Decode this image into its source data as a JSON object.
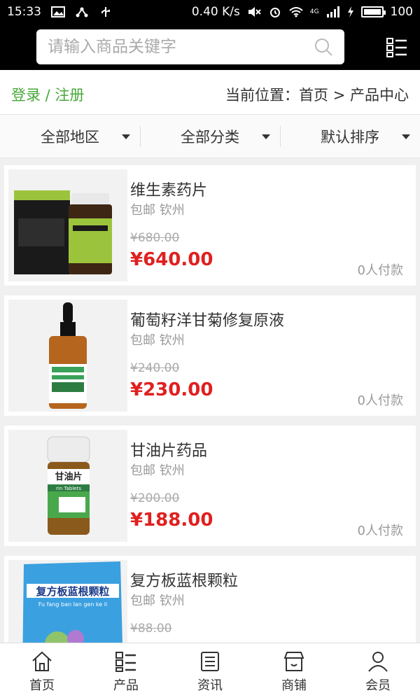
{
  "status_bar": {
    "time": "15:33",
    "speed": "0.40 K/s",
    "network": "4G",
    "battery": "100"
  },
  "search": {
    "placeholder": "请输入商品关键字"
  },
  "breadcrumb": {
    "login": "登录 / 注册",
    "location": "当前位置：首页 > 产品中心"
  },
  "filters": [
    {
      "label": "全部地区"
    },
    {
      "label": "全部分类"
    },
    {
      "label": "默认排序"
    }
  ],
  "products": [
    {
      "name": "维生素药片",
      "shipping": "包邮 钦州",
      "old_price": "¥680.00",
      "price": "¥640.00",
      "paid": "0人付款",
      "image": "vitamin-bottle-and-box"
    },
    {
      "name": "葡萄籽洋甘菊修复原液",
      "shipping": "包邮 钦州",
      "old_price": "¥240.00",
      "price": "¥230.00",
      "paid": "0人付款",
      "image": "dropper-bottle"
    },
    {
      "name": "甘油片药品",
      "shipping": "包邮 钦州",
      "old_price": "¥200.00",
      "price": "¥188.00",
      "paid": "0人付款",
      "image": "glycerin-tablets-bottle",
      "image_text": {
        "line1": "甘油片",
        "line2": "rin Tablets"
      }
    },
    {
      "name": "复方板蓝根颗粒",
      "shipping": "包邮 钦州",
      "old_price": "¥88.00",
      "price": "",
      "paid": "",
      "image": "banlangen-granules-pack",
      "image_text": {
        "line1": "复方板蓝根颗粒",
        "line2": "Fu fang ban lan gen ke li"
      }
    }
  ],
  "bottom_nav": [
    {
      "label": "首页",
      "icon": "home-icon"
    },
    {
      "label": "产品",
      "icon": "grid-list-icon"
    },
    {
      "label": "资讯",
      "icon": "news-icon"
    },
    {
      "label": "商铺",
      "icon": "store-icon"
    },
    {
      "label": "会员",
      "icon": "user-icon"
    }
  ],
  "colors": {
    "accent_green": "#48a83a",
    "price_red": "#e02020",
    "header_bg": "#000000"
  }
}
